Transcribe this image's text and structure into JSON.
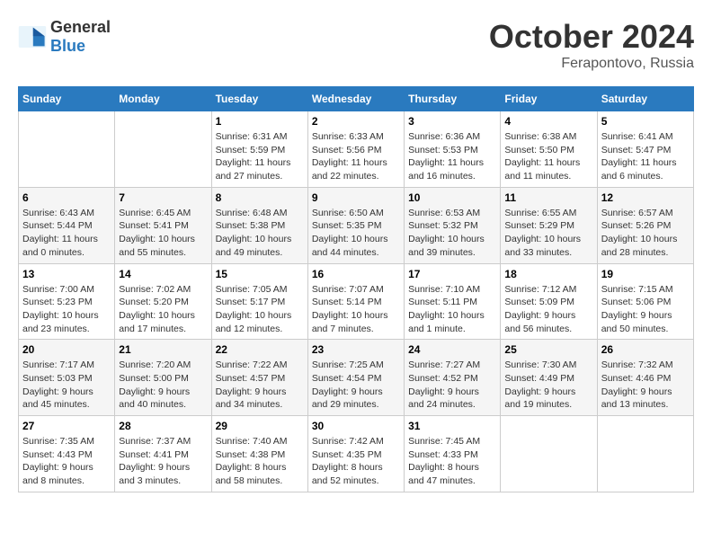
{
  "header": {
    "logo_general": "General",
    "logo_blue": "Blue",
    "title": "October 2024",
    "location": "Ferapontovo, Russia"
  },
  "columns": [
    "Sunday",
    "Monday",
    "Tuesday",
    "Wednesday",
    "Thursday",
    "Friday",
    "Saturday"
  ],
  "weeks": [
    [
      {
        "day": "",
        "empty": true
      },
      {
        "day": "",
        "empty": true
      },
      {
        "day": "1",
        "sunrise": "6:31 AM",
        "sunset": "5:59 PM",
        "daylight": "11 hours and 27 minutes."
      },
      {
        "day": "2",
        "sunrise": "6:33 AM",
        "sunset": "5:56 PM",
        "daylight": "11 hours and 22 minutes."
      },
      {
        "day": "3",
        "sunrise": "6:36 AM",
        "sunset": "5:53 PM",
        "daylight": "11 hours and 16 minutes."
      },
      {
        "day": "4",
        "sunrise": "6:38 AM",
        "sunset": "5:50 PM",
        "daylight": "11 hours and 11 minutes."
      },
      {
        "day": "5",
        "sunrise": "6:41 AM",
        "sunset": "5:47 PM",
        "daylight": "11 hours and 6 minutes."
      }
    ],
    [
      {
        "day": "6",
        "sunrise": "6:43 AM",
        "sunset": "5:44 PM",
        "daylight": "11 hours and 0 minutes."
      },
      {
        "day": "7",
        "sunrise": "6:45 AM",
        "sunset": "5:41 PM",
        "daylight": "10 hours and 55 minutes."
      },
      {
        "day": "8",
        "sunrise": "6:48 AM",
        "sunset": "5:38 PM",
        "daylight": "10 hours and 49 minutes."
      },
      {
        "day": "9",
        "sunrise": "6:50 AM",
        "sunset": "5:35 PM",
        "daylight": "10 hours and 44 minutes."
      },
      {
        "day": "10",
        "sunrise": "6:53 AM",
        "sunset": "5:32 PM",
        "daylight": "10 hours and 39 minutes."
      },
      {
        "day": "11",
        "sunrise": "6:55 AM",
        "sunset": "5:29 PM",
        "daylight": "10 hours and 33 minutes."
      },
      {
        "day": "12",
        "sunrise": "6:57 AM",
        "sunset": "5:26 PM",
        "daylight": "10 hours and 28 minutes."
      }
    ],
    [
      {
        "day": "13",
        "sunrise": "7:00 AM",
        "sunset": "5:23 PM",
        "daylight": "10 hours and 23 minutes."
      },
      {
        "day": "14",
        "sunrise": "7:02 AM",
        "sunset": "5:20 PM",
        "daylight": "10 hours and 17 minutes."
      },
      {
        "day": "15",
        "sunrise": "7:05 AM",
        "sunset": "5:17 PM",
        "daylight": "10 hours and 12 minutes."
      },
      {
        "day": "16",
        "sunrise": "7:07 AM",
        "sunset": "5:14 PM",
        "daylight": "10 hours and 7 minutes."
      },
      {
        "day": "17",
        "sunrise": "7:10 AM",
        "sunset": "5:11 PM",
        "daylight": "10 hours and 1 minute."
      },
      {
        "day": "18",
        "sunrise": "7:12 AM",
        "sunset": "5:09 PM",
        "daylight": "9 hours and 56 minutes."
      },
      {
        "day": "19",
        "sunrise": "7:15 AM",
        "sunset": "5:06 PM",
        "daylight": "9 hours and 50 minutes."
      }
    ],
    [
      {
        "day": "20",
        "sunrise": "7:17 AM",
        "sunset": "5:03 PM",
        "daylight": "9 hours and 45 minutes."
      },
      {
        "day": "21",
        "sunrise": "7:20 AM",
        "sunset": "5:00 PM",
        "daylight": "9 hours and 40 minutes."
      },
      {
        "day": "22",
        "sunrise": "7:22 AM",
        "sunset": "4:57 PM",
        "daylight": "9 hours and 34 minutes."
      },
      {
        "day": "23",
        "sunrise": "7:25 AM",
        "sunset": "4:54 PM",
        "daylight": "9 hours and 29 minutes."
      },
      {
        "day": "24",
        "sunrise": "7:27 AM",
        "sunset": "4:52 PM",
        "daylight": "9 hours and 24 minutes."
      },
      {
        "day": "25",
        "sunrise": "7:30 AM",
        "sunset": "4:49 PM",
        "daylight": "9 hours and 19 minutes."
      },
      {
        "day": "26",
        "sunrise": "7:32 AM",
        "sunset": "4:46 PM",
        "daylight": "9 hours and 13 minutes."
      }
    ],
    [
      {
        "day": "27",
        "sunrise": "7:35 AM",
        "sunset": "4:43 PM",
        "daylight": "9 hours and 8 minutes."
      },
      {
        "day": "28",
        "sunrise": "7:37 AM",
        "sunset": "4:41 PM",
        "daylight": "9 hours and 3 minutes."
      },
      {
        "day": "29",
        "sunrise": "7:40 AM",
        "sunset": "4:38 PM",
        "daylight": "8 hours and 58 minutes."
      },
      {
        "day": "30",
        "sunrise": "7:42 AM",
        "sunset": "4:35 PM",
        "daylight": "8 hours and 52 minutes."
      },
      {
        "day": "31",
        "sunrise": "7:45 AM",
        "sunset": "4:33 PM",
        "daylight": "8 hours and 47 minutes."
      },
      {
        "day": "",
        "empty": true
      },
      {
        "day": "",
        "empty": true
      }
    ]
  ]
}
